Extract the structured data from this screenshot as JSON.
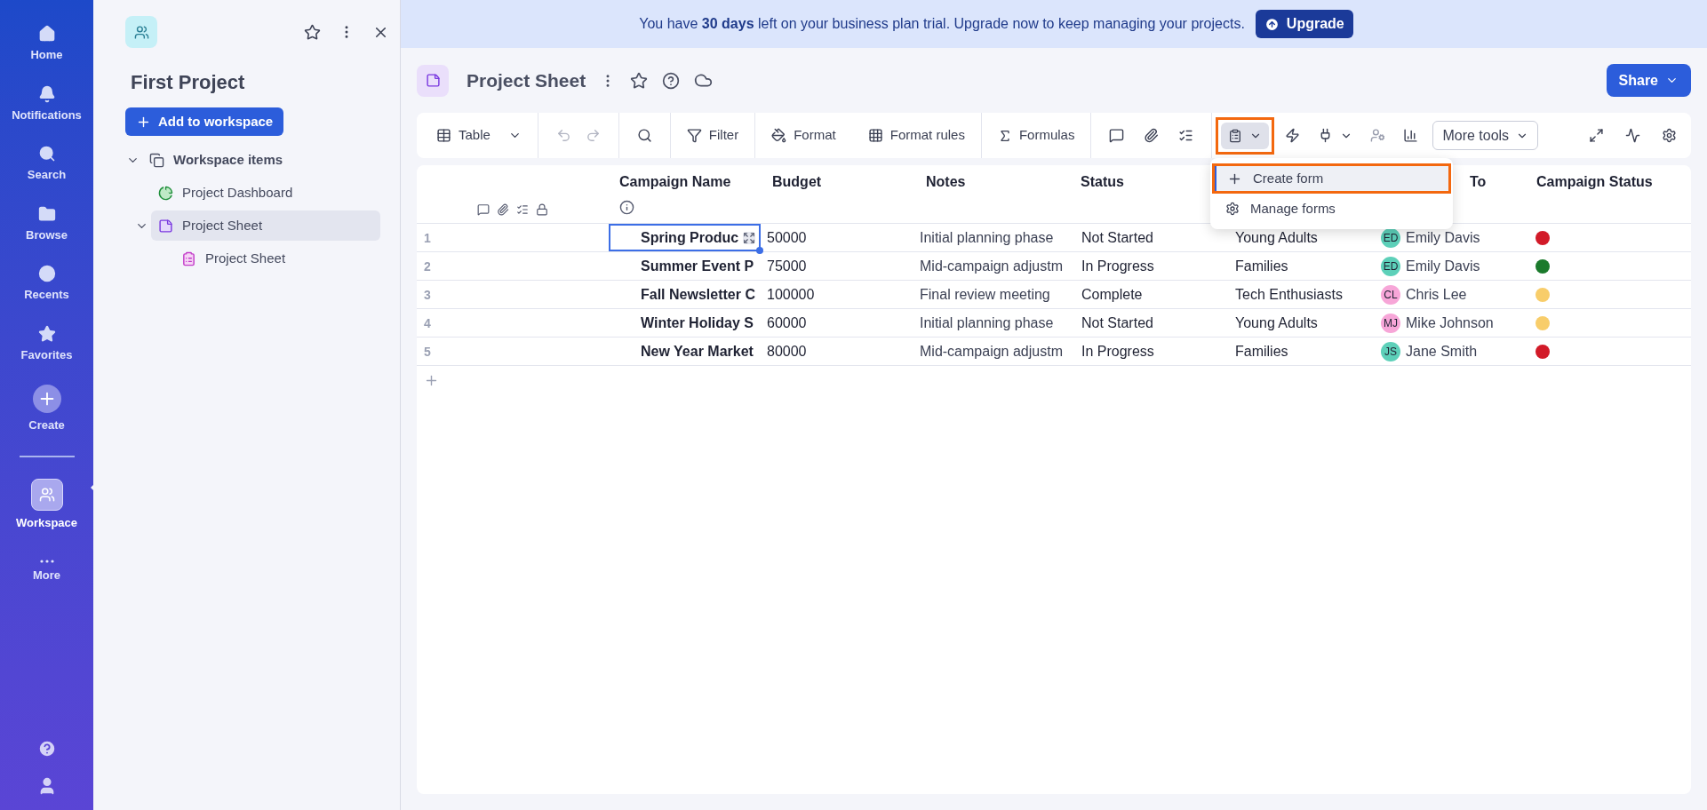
{
  "nav": {
    "items": [
      {
        "label": "Home",
        "selected": false
      },
      {
        "label": "Notifications",
        "selected": false
      },
      {
        "label": "Search",
        "selected": false
      },
      {
        "label": "Browse",
        "selected": false
      },
      {
        "label": "Recents",
        "selected": false
      },
      {
        "label": "Favorites",
        "selected": false
      },
      {
        "label": "Create",
        "selected": false
      },
      {
        "label": "Workspace",
        "selected": true
      },
      {
        "label": "More",
        "selected": false
      }
    ]
  },
  "sidebar": {
    "title": "First Project",
    "add_button": "Add to workspace",
    "tree": [
      {
        "label": "Workspace items",
        "kind": "group",
        "expanded": true,
        "selected": false,
        "children": [
          {
            "label": "Project Dashboard",
            "kind": "dashboard",
            "selected": false
          },
          {
            "label": "Project Sheet",
            "kind": "sheet",
            "expanded": true,
            "selected": true,
            "children": [
              {
                "label": "Project Sheet",
                "kind": "form",
                "selected": false
              }
            ]
          }
        ]
      }
    ]
  },
  "banner": {
    "text": "You have **30 days** left on your business plan trial. Upgrade now to keep managing your projects.",
    "button": "Upgrade"
  },
  "header": {
    "title": "Project Sheet",
    "share": "Share"
  },
  "toolbar": {
    "view": "Table",
    "history": {
      "disabled": true
    },
    "filter": "Filter",
    "format": "Format",
    "format_rules": "Format rules",
    "formulas": "Formulas",
    "forms": {
      "open": true,
      "highlighted": true
    },
    "more_tools": "More tools"
  },
  "forms_menu": [
    {
      "label": "Create form",
      "kind": "create",
      "selected": true,
      "highlighted": true
    },
    {
      "label": "Manage forms",
      "kind": "manage",
      "selected": false,
      "highlighted": false
    }
  ],
  "table": {
    "columns": [
      "Campaign Name",
      "Budget",
      "Notes",
      "Status",
      null,
      "To",
      "Campaign Status"
    ],
    "rows": [
      {
        "number": "1",
        "name": "Spring Produc",
        "selected": true,
        "budget": "50000",
        "notes": "Initial planning phase",
        "status": "Not Started",
        "audience": "Young Adults",
        "assignee": {
          "initials": "ED",
          "name": "Emily Davis",
          "color": "#5dd0b9"
        },
        "campaign_status": {
          "color": "#d21a28"
        }
      },
      {
        "number": "2",
        "name": "Summer Event P",
        "selected": false,
        "budget": "75000",
        "notes": "Mid-campaign adjustm",
        "status": "In Progress",
        "audience": "Families",
        "assignee": {
          "initials": "ED",
          "name": "Emily Davis",
          "color": "#5dd0b9"
        },
        "campaign_status": {
          "color": "#1b7a2c"
        }
      },
      {
        "number": "3",
        "name": "Fall Newsletter C",
        "selected": false,
        "budget": "100000",
        "notes": "Final review meeting",
        "status": "Complete",
        "audience": "Tech Enthusiasts",
        "assignee": {
          "initials": "CL",
          "name": "Chris Lee",
          "color": "#f7a6d8"
        },
        "campaign_status": {
          "color": "#f8cd6a"
        }
      },
      {
        "number": "4",
        "name": "Winter Holiday S",
        "selected": false,
        "budget": "60000",
        "notes": "Initial planning phase",
        "status": "Not Started",
        "audience": "Young Adults",
        "assignee": {
          "initials": "MJ",
          "name": "Mike Johnson",
          "color": "#f7a6d8"
        },
        "campaign_status": {
          "color": "#f8cd6a"
        }
      },
      {
        "number": "5",
        "name": "New Year Market",
        "selected": false,
        "budget": "80000",
        "notes": "Mid-campaign adjustm",
        "status": "In Progress",
        "audience": "Families",
        "assignee": {
          "initials": "JS",
          "name": "Jane Smith",
          "color": "#5dd0b9"
        },
        "campaign_status": {
          "color": "#d21a28"
        }
      }
    ]
  }
}
